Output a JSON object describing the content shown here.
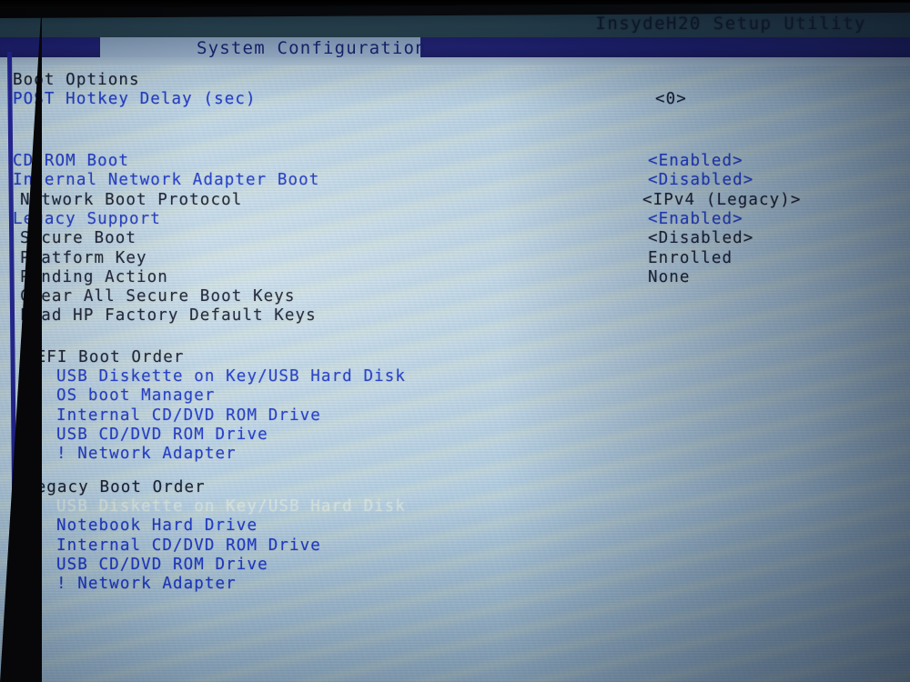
{
  "header": {
    "utility_title": "InsydeH20 Setup Utility",
    "active_tab": "System Configuration"
  },
  "sections": {
    "boot_options_heading": "Boot Options",
    "uefi_heading": "UEFI Boot Order",
    "legacy_heading": "Legacy Boot Order"
  },
  "settings": [
    {
      "label": "POST Hotkey Delay (sec)",
      "value": "<0>",
      "label_style": "blue",
      "value_style": "dark"
    },
    {
      "label": "CD-ROM Boot",
      "value": "<Enabled>",
      "label_style": "blue",
      "value_style": "blue"
    },
    {
      "label": "Internal Network Adapter Boot",
      "value": "<Disabled>",
      "label_style": "blue",
      "value_style": "blue"
    },
    {
      "label": "Network Boot Protocol",
      "value": "<IPv4 (Legacy)>",
      "label_style": "dark",
      "value_style": "dark"
    },
    {
      "label": "Legacy Support",
      "value": "<Enabled>",
      "label_style": "blue",
      "value_style": "blue"
    },
    {
      "label": "Secure Boot",
      "value": "<Disabled>",
      "label_style": "dark",
      "value_style": "dark"
    },
    {
      "label": "Platform Key",
      "value": "Enrolled",
      "label_style": "dark",
      "value_style": "dark"
    },
    {
      "label": "Pending Action",
      "value": "None",
      "label_style": "dark",
      "value_style": "dark"
    }
  ],
  "actions": [
    {
      "label": "Clear All Secure Boot Keys"
    },
    {
      "label": "Load HP Factory Default Keys"
    }
  ],
  "uefi_boot_order": [
    {
      "label": "USB Diskette on Key/USB Hard Disk",
      "style": "blue"
    },
    {
      "label": "OS boot Manager",
      "style": "blue"
    },
    {
      "label": "Internal CD/DVD ROM Drive",
      "style": "blue"
    },
    {
      "label": "USB CD/DVD ROM Drive",
      "style": "blue"
    },
    {
      "label": "! Network Adapter",
      "style": "blue"
    }
  ],
  "legacy_boot_order": [
    {
      "label": "USB Diskette on Key/USB Hard Disk",
      "style": "dim"
    },
    {
      "label": "Notebook Hard Drive",
      "style": "blue"
    },
    {
      "label": "Internal CD/DVD ROM Drive",
      "style": "blue"
    },
    {
      "label": "USB CD/DVD ROM Drive",
      "style": "blue"
    },
    {
      "label": "! Network Adapter",
      "style": "blue"
    }
  ],
  "colors": {
    "label_blue": "#1b37c4",
    "label_dark": "#141a2e",
    "dim_item": "#e6ecd8",
    "tab_band": "#1b1c73",
    "header_band": "#24404d",
    "panel_border": "#1c1c8c"
  }
}
